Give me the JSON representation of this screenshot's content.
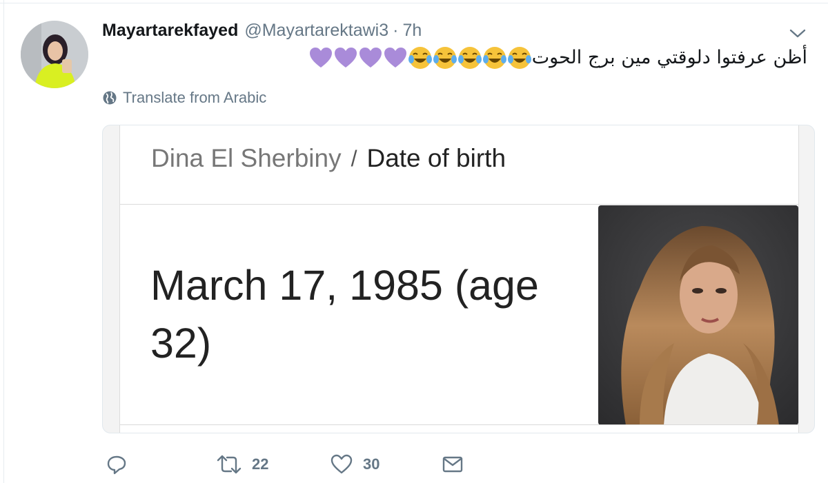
{
  "tweet": {
    "display_name": "Mayartarekfayed",
    "screen_name": "@Mayartarektawi3",
    "separator": "·",
    "time": "7h",
    "text": "أظن عرفتوا دلوقتي مين برج الحوت",
    "emojis": [
      "face-with-tears-of-joy",
      "face-with-tears-of-joy",
      "face-with-tears-of-joy",
      "face-with-tears-of-joy",
      "face-with-tears-of-joy",
      "purple-heart",
      "purple-heart",
      "purple-heart",
      "purple-heart"
    ],
    "translate_label": "Translate from Arabic"
  },
  "card": {
    "entity": "Dina El Sherbiny",
    "separator": "/",
    "attribute": "Date of birth",
    "value": "March 17, 1985 (age 32)"
  },
  "actions": {
    "reply_count": "",
    "retweet_count": "22",
    "like_count": "30"
  },
  "colors": {
    "secondary_text": "#657786",
    "purple_heart": "#a98bd9",
    "emoji_yellow": "#f6c33a",
    "border": "#e1e8ed"
  }
}
